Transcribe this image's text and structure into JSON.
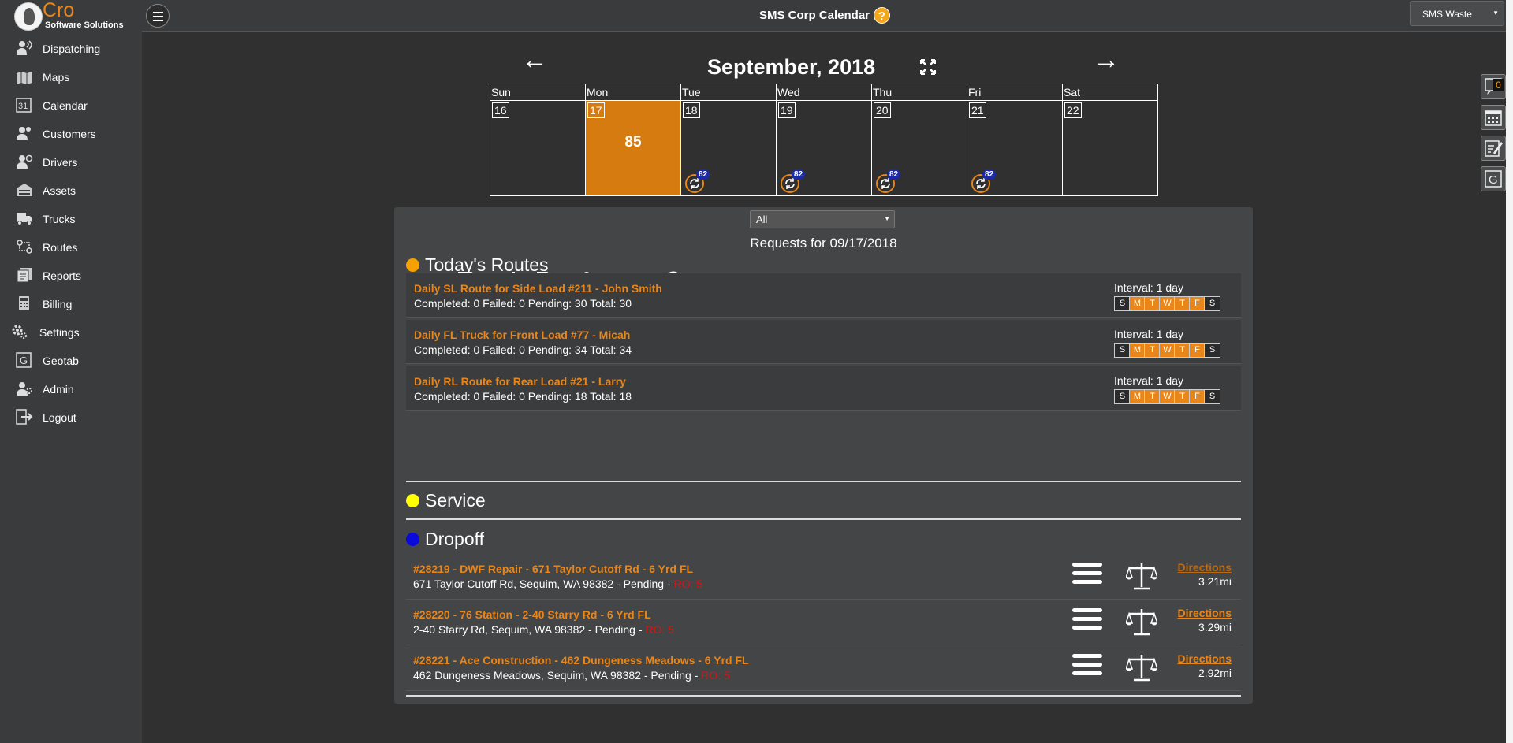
{
  "brand": {
    "name": "Cro",
    "tagline": "Software Solutions",
    "logo_icon": "bird-logo-icon"
  },
  "sidebar": {
    "items": [
      {
        "label": "Dispatching",
        "icon": "dispatch-icon"
      },
      {
        "label": "Maps",
        "icon": "map-icon"
      },
      {
        "label": "Calendar",
        "icon": "calendar-icon"
      },
      {
        "label": "Customers",
        "icon": "customers-icon"
      },
      {
        "label": "Drivers",
        "icon": "drivers-icon"
      },
      {
        "label": "Assets",
        "icon": "assets-icon"
      },
      {
        "label": "Trucks",
        "icon": "truck-icon"
      },
      {
        "label": "Routes",
        "icon": "routes-icon"
      },
      {
        "label": "Reports",
        "icon": "reports-icon"
      },
      {
        "label": "Billing",
        "icon": "billing-icon"
      },
      {
        "label": "Settings",
        "icon": "gear-icon"
      },
      {
        "label": "Geotab",
        "icon": "geotab-icon"
      },
      {
        "label": "Admin",
        "icon": "admin-icon"
      },
      {
        "label": "Logout",
        "icon": "logout-icon"
      }
    ]
  },
  "header": {
    "title": "SMS Corp Calendar",
    "help": "?",
    "company": "SMS Waste"
  },
  "right_widgets": {
    "notification_count": "0"
  },
  "calendar": {
    "prev": "←",
    "next": "→",
    "title": "September, 2018",
    "weekdays": [
      "Sun",
      "Mon",
      "Tue",
      "Wed",
      "Thu",
      "Fri",
      "Sat"
    ],
    "days": [
      {
        "num": "16",
        "count": "",
        "recur": ""
      },
      {
        "num": "17",
        "count": "85",
        "recur": ""
      },
      {
        "num": "18",
        "count": "",
        "recur": "82"
      },
      {
        "num": "19",
        "count": "",
        "recur": "82"
      },
      {
        "num": "20",
        "count": "",
        "recur": "82"
      },
      {
        "num": "21",
        "count": "",
        "recur": "82"
      },
      {
        "num": "22",
        "count": "",
        "recur": ""
      }
    ],
    "selected_index": 1,
    "selected_color": "#d67b10"
  },
  "panel": {
    "filter": "All",
    "requests_title": "Requests for 09/17/2018",
    "tools": [
      "printer-icon",
      "add-document-icon",
      "target-icon",
      "truck-document-icon",
      "map-fold-icon",
      "clock-document-icon",
      "map-pin-icon"
    ]
  },
  "sections": {
    "routes": {
      "title": "Today's Routes",
      "color": "#f5a200"
    },
    "service": {
      "title": "Service",
      "color": "#ffff00"
    },
    "dropoff": {
      "title": "Dropoff",
      "color": "#0a0adc"
    }
  },
  "routes": [
    {
      "title": "Daily SL Route for Side Load #211 - John Smith",
      "stats": "Completed: 0 Failed: 0 Pending: 30 Total: 30",
      "interval": "Interval: 1 day"
    },
    {
      "title": "Daily FL Truck for Front Load #77 - Micah",
      "stats": "Completed: 0 Failed: 0 Pending: 34 Total: 34",
      "interval": "Interval: 1 day"
    },
    {
      "title": "Daily RL Route for Rear Load #21 - Larry",
      "stats": "Completed: 0 Failed: 0 Pending: 18 Total: 18",
      "interval": "Interval: 1 day"
    }
  ],
  "week_letters": [
    "S",
    "M",
    "T",
    "W",
    "T",
    "F",
    "S"
  ],
  "active_days": [
    false,
    true,
    true,
    true,
    true,
    true,
    false
  ],
  "dropoffs": [
    {
      "title": "#28219 - DWF Repair - 671 Taylor Cutoff Rd - 6 Yrd FL",
      "address": "671 Taylor Cutoff Rd, Sequim, WA 98382 - Pending - ",
      "ro": "RO: 5",
      "directions": "Directions",
      "distance": "3.21mi"
    },
    {
      "title": "#28220 - 76 Station - 2-40 Starry Rd - 6 Yrd FL",
      "address": "2-40 Starry Rd, Sequim, WA 98382 - Pending - ",
      "ro": "RO: 5",
      "directions": "Directions",
      "distance": "3.29mi"
    },
    {
      "title": "#28221 - Ace Construction - 462 Dungeness Meadows - 6 Yrd FL",
      "address": "462 Dungeness Meadows, Sequim, WA 98382 - Pending - ",
      "ro": "RO: 5",
      "directions": "Directions",
      "distance": "2.92mi"
    }
  ]
}
